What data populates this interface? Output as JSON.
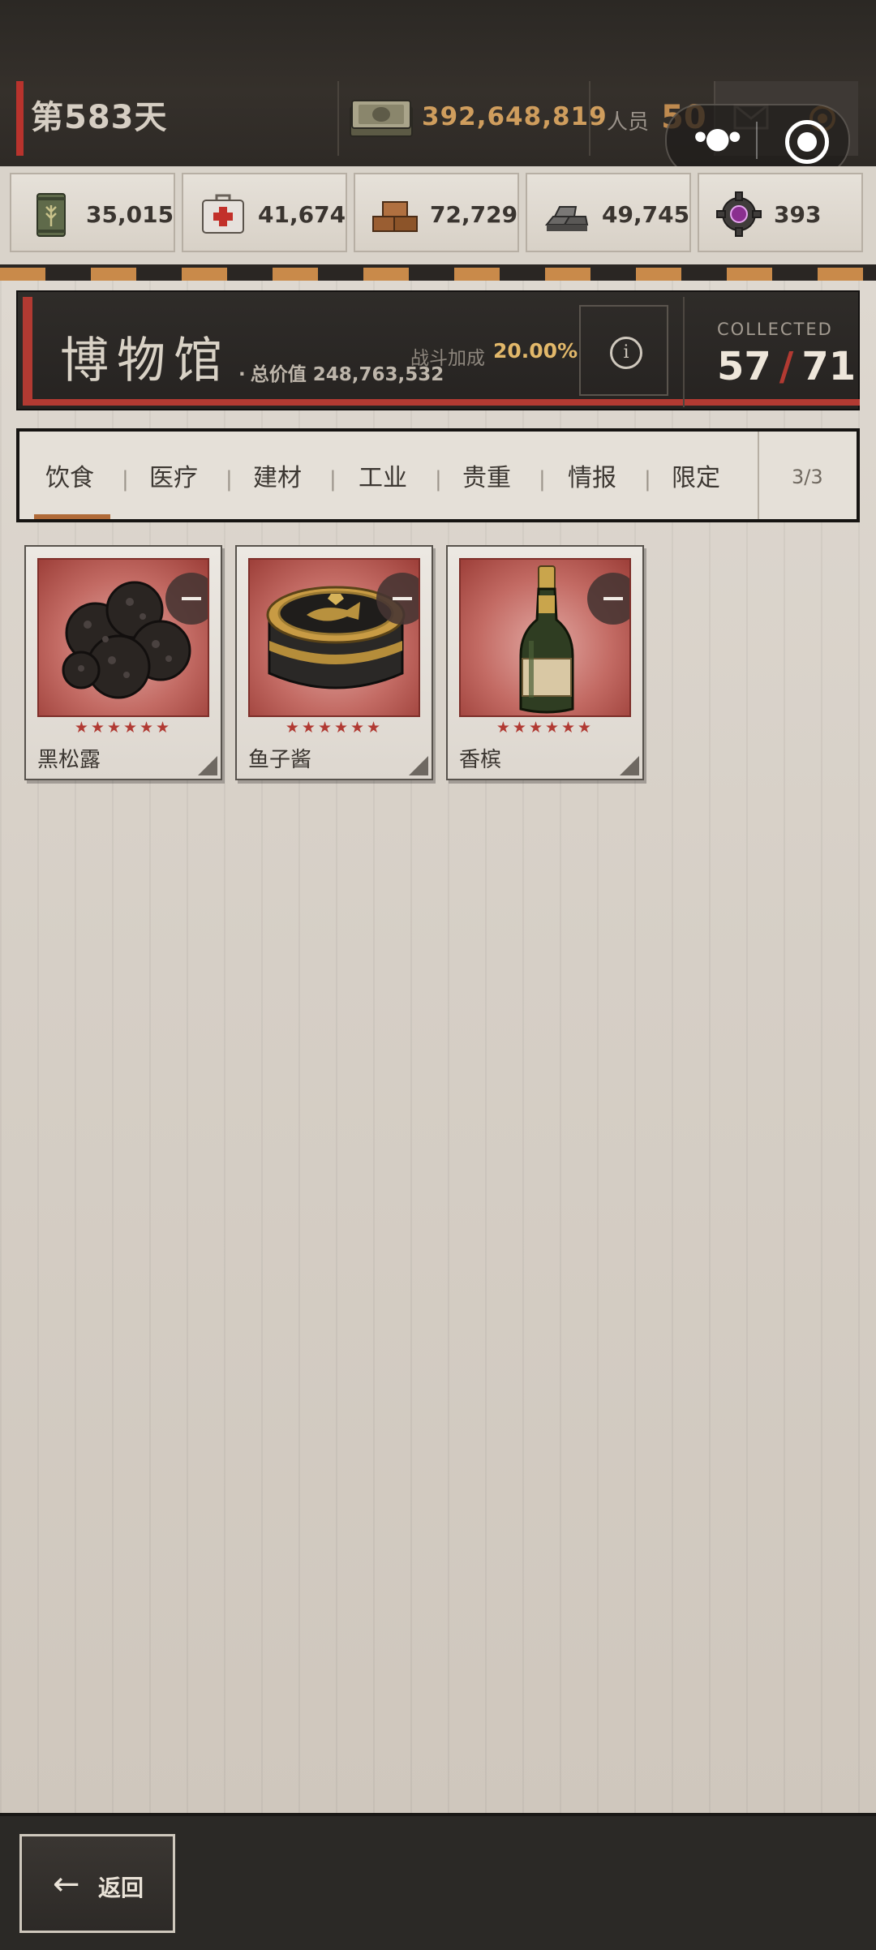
{
  "header": {
    "day_label": "第583天",
    "cash": "392,648,819",
    "staff_label": "人员",
    "staff_value": "50"
  },
  "resources": [
    {
      "name": "grain-can-icon",
      "value": "35,015"
    },
    {
      "name": "medkit-icon",
      "value": "41,674"
    },
    {
      "name": "wood-planks-icon",
      "value": "72,729"
    },
    {
      "name": "metal-ingots-icon",
      "value": "49,745"
    },
    {
      "name": "gear-gem-icon",
      "value": "393"
    }
  ],
  "museum": {
    "title": "博物馆",
    "total_value_dot": "·",
    "total_value_label": "总价值 248,763,532",
    "bonus_label": "战斗加成",
    "bonus_value": "20.00%",
    "info_glyph": "i",
    "collected_label": "COLLECTED",
    "collected_current": "57",
    "collected_slash": "/",
    "collected_total": "71"
  },
  "tabs": {
    "items": [
      "饮食",
      "医疗",
      "建材",
      "工业",
      "贵重",
      "情报",
      "限定"
    ],
    "separator": "|",
    "page": "3/3"
  },
  "items": [
    {
      "name": "黑松露",
      "stars": "★★★★★★"
    },
    {
      "name": "鱼子酱",
      "stars": "★★★★★★"
    },
    {
      "name": "香槟",
      "stars": "★★★★★★"
    }
  ],
  "footer": {
    "back_arrow": "←",
    "back_label": "返回"
  },
  "colors": {
    "accent_red": "#b23a32",
    "cash_gold": "#cf9d5d",
    "bonus_gold": "#e2b86a",
    "tab_underline": "#b06a38"
  }
}
